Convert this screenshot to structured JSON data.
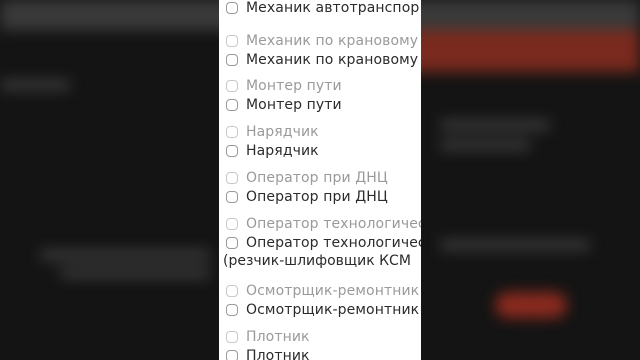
{
  "options": [
    {
      "faded": "",
      "label": "Механик автотранспор"
    },
    {
      "faded": "Механик по крановому",
      "label": "Механик по крановому"
    },
    {
      "faded": "Монтер пути",
      "label": "Монтер пути"
    },
    {
      "faded": "Нарядчик",
      "label": "Нарядчик"
    },
    {
      "faded": "Оператор при ДНЦ",
      "label": "Оператор при ДНЦ"
    },
    {
      "faded": "Оператор технологичес",
      "label": "Оператор технологичес",
      "label2": "(резчик-шлифовщик КСМ"
    },
    {
      "faded": "Осмотрщик-ремонтник",
      "label": "Осмотрщик-ремонтник"
    },
    {
      "faded": "Плотник",
      "label": "Плотник"
    }
  ]
}
